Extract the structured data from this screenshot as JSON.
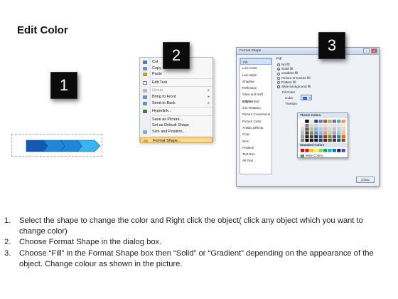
{
  "title": "Edit Color",
  "badges": [
    "1",
    "2",
    "3"
  ],
  "shape": {
    "colors": {
      "dark": "#1559b3",
      "mid": "#1f86d8",
      "light": "#38b4ee"
    }
  },
  "context_menu": {
    "items": [
      {
        "label": "Cut",
        "icon": "scissors-icon",
        "color": "#5577aa",
        "disabled": false,
        "submenu": false
      },
      {
        "label": "Copy",
        "icon": "copy-icon",
        "color": "#6a8fc8",
        "disabled": false,
        "submenu": false
      },
      {
        "label": "Paste",
        "icon": "paste-icon",
        "color": "#c99a3c",
        "disabled": false,
        "submenu": false
      },
      {
        "label": "Edit Text",
        "icon": "edit-text-icon",
        "color": "#ffffff",
        "disabled": false,
        "submenu": false
      },
      {
        "label": "Group",
        "icon": "group-icon",
        "color": "#bbbbbb",
        "disabled": true,
        "submenu": true
      },
      {
        "label": "Bring to Front",
        "icon": "bring-front-icon",
        "color": "#6b8ec4",
        "disabled": false,
        "submenu": true
      },
      {
        "label": "Send to Back",
        "icon": "send-back-icon",
        "color": "#6b8ec4",
        "disabled": false,
        "submenu": true
      },
      {
        "label": "Hyperlink...",
        "icon": "hyperlink-icon",
        "color": "#3a7a3a",
        "disabled": false,
        "submenu": false
      },
      {
        "label": "Save as Picture...",
        "icon": "",
        "color": "",
        "disabled": false,
        "submenu": false
      },
      {
        "label": "Set as Default Shape",
        "icon": "",
        "color": "",
        "disabled": false,
        "submenu": false
      },
      {
        "label": "Size and Position...",
        "icon": "size-position-icon",
        "color": "#8aa6cc",
        "disabled": false,
        "submenu": false
      },
      {
        "label": "Format Shape...",
        "icon": "format-shape-icon",
        "color": "#e0a73a",
        "disabled": false,
        "submenu": false
      }
    ]
  },
  "dialog": {
    "title": "Format Shape",
    "title_buttons": [
      "?",
      "X"
    ],
    "categories": [
      "Fill",
      "Line Color",
      "Line Style",
      "Shadow",
      "Reflection",
      "Glow and Soft Edges",
      "3-D Format",
      "3-D Rotation",
      "Picture Corrections",
      "Picture Color",
      "Artistic Effects",
      "Crop",
      "Size",
      "Position",
      "Text Box",
      "Alt Text"
    ],
    "fill_heading": "Fill",
    "fill_options": [
      "No fill",
      "Solid fill",
      "Gradient fill",
      "Picture or texture fill",
      "Pattern fill"
    ],
    "selected_option": "Solid fill",
    "slide_bg_label": "Slide background fill",
    "fill_color_label": "Fill Color",
    "color_label": "Color:",
    "current_color": "#2f6fbe",
    "transparency_label": "Transpa",
    "close_label": "Close",
    "popup": {
      "theme_header": "Theme Colors",
      "theme_top": [
        "#ffffff",
        "#000000",
        "#eeece1",
        "#1f497d",
        "#4f81bd",
        "#c0504d",
        "#9bbb59",
        "#8064a2",
        "#4bacc6",
        "#f79646"
      ],
      "theme_shades": [
        [
          "#f2f2f2",
          "#7f7f7f",
          "#ddd9c3",
          "#c6d9f0",
          "#dbe5f1",
          "#f2dcdb",
          "#ebf1dd",
          "#e5e0ec",
          "#dbeef3",
          "#fdeada"
        ],
        [
          "#d8d8d8",
          "#595959",
          "#c4bd97",
          "#8db3e2",
          "#b8cce4",
          "#e5b9b7",
          "#d7e3bc",
          "#ccc1d9",
          "#b7dde8",
          "#fbd5b5"
        ],
        [
          "#bfbfbf",
          "#3f3f3f",
          "#938953",
          "#548dd4",
          "#95b3d7",
          "#d99694",
          "#c3d69b",
          "#b2a2c7",
          "#92cddc",
          "#fac08f"
        ],
        [
          "#a5a5a5",
          "#262626",
          "#494429",
          "#17365d",
          "#366092",
          "#953734",
          "#76923c",
          "#5f497a",
          "#31859b",
          "#e36c09"
        ],
        [
          "#7f7f7f",
          "#0c0c0c",
          "#1d1b10",
          "#0f243e",
          "#244061",
          "#632423",
          "#4f6128",
          "#3f3151",
          "#205867",
          "#974806"
        ]
      ],
      "standard_header": "Standard Colors",
      "standard": [
        "#c00000",
        "#ff0000",
        "#ffc000",
        "#ffff00",
        "#92d050",
        "#00b050",
        "#00b0f0",
        "#0070c0",
        "#002060",
        "#7030a0"
      ],
      "more_label": "More Colors..."
    }
  },
  "steps": [
    {
      "num": "1.",
      "text": "Select the shape to change the color and Right click the object( click any object which you want to change color)"
    },
    {
      "num": "2.",
      "text": "Choose Format Shape in the dialog box."
    },
    {
      "num": "3.",
      "text": "Choose “Fill” in the Format Shape box then “Solid” or “Gradient” depending on the appearance of the object. Change colour as shown in the picture."
    }
  ]
}
